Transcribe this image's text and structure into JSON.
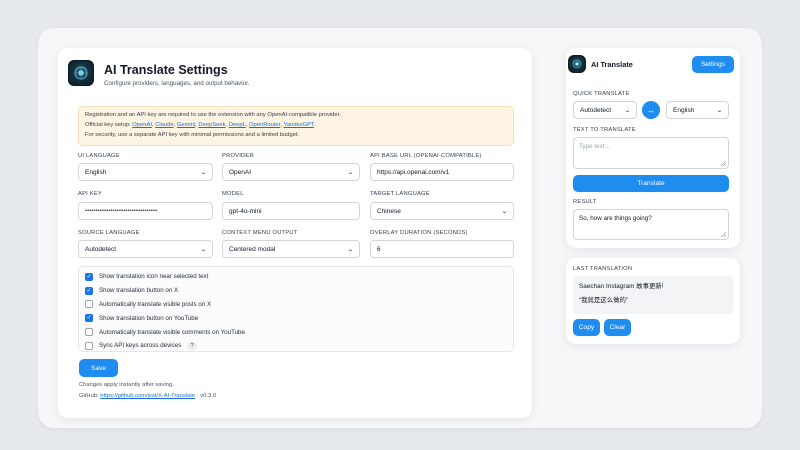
{
  "settings": {
    "title": "AI Translate Settings",
    "subtitle": "Configure providers, languages, and output behavior.",
    "notice": {
      "line1": "Registration and an API key are required to use the extension with any OpenAI-compatible provider.",
      "line2_prefix": "Official key setup:",
      "providers": [
        "OpenAI",
        "Claude",
        "Gemini",
        "DeepSeek",
        "DeepL",
        "OpenRouter",
        "YandexGPT"
      ],
      "line3": "For security, use a separate API key with minimal permissions and a limited budget."
    },
    "fields": {
      "ui_language": {
        "label": "UI LANGUAGE",
        "value": "English"
      },
      "provider": {
        "label": "PROVIDER",
        "value": "OpenAI"
      },
      "api_base_url": {
        "label": "API BASE URL (OPENAI-COMPATIBLE)",
        "value": "https://api.openai.com/v1"
      },
      "api_key": {
        "label": "API KEY",
        "value": "••••••••••••••••••••••••••••••••••"
      },
      "model": {
        "label": "MODEL",
        "value": "gpt-4o-mini"
      },
      "target_language": {
        "label": "TARGET LANGUAGE",
        "value": "Chinese"
      },
      "source_language": {
        "label": "SOURCE LANGUAGE",
        "value": "Autodetect"
      },
      "context_menu_output": {
        "label": "CONTEXT MENU OUTPUT",
        "value": "Centered modal"
      },
      "overlay_duration": {
        "label": "OVERLAY DURATION (SECONDS)",
        "value": "6"
      }
    },
    "checkboxes": [
      {
        "label": "Show translation icon near selected text",
        "checked": true
      },
      {
        "label": "Show translation button on X",
        "checked": true
      },
      {
        "label": "Automatically translate visible posts on X",
        "checked": false
      },
      {
        "label": "Show translation button on YouTube",
        "checked": true
      },
      {
        "label": "Automatically translate visible comments on YouTube",
        "checked": false
      },
      {
        "label": "Sync API keys across devices",
        "checked": false,
        "help": "?"
      }
    ],
    "save_label": "Save",
    "footer_note": "Changes apply instantly after saving.",
    "github_prefix": "GitHub:",
    "github_link": "https://github.com/jvst/X-AI-Translate",
    "version": "·  v0.3.0"
  },
  "popup": {
    "title": "AI Translate",
    "settings_button": "Settings",
    "quick_translate_label": "QUICK TRANSLATE",
    "source_select": "Autodetect",
    "target_select": "English",
    "swap_icon": "↔",
    "text_label": "TEXT TO TRANSLATE",
    "text_placeholder": "Type text...",
    "translate_button": "Translate",
    "result_label": "RESULT",
    "result_text": "So, how are things going?"
  },
  "last": {
    "label": "LAST TRANSLATION",
    "line1": "Saechan Instagram 故事更新!",
    "line2": "“我就是这么做的”",
    "copy_button": "Copy",
    "clear_button": "Clear"
  },
  "colors": {
    "accent": "#1f8cf0",
    "notice_bg": "#fdf4e4",
    "checkbox_on": "#1a73e8"
  }
}
